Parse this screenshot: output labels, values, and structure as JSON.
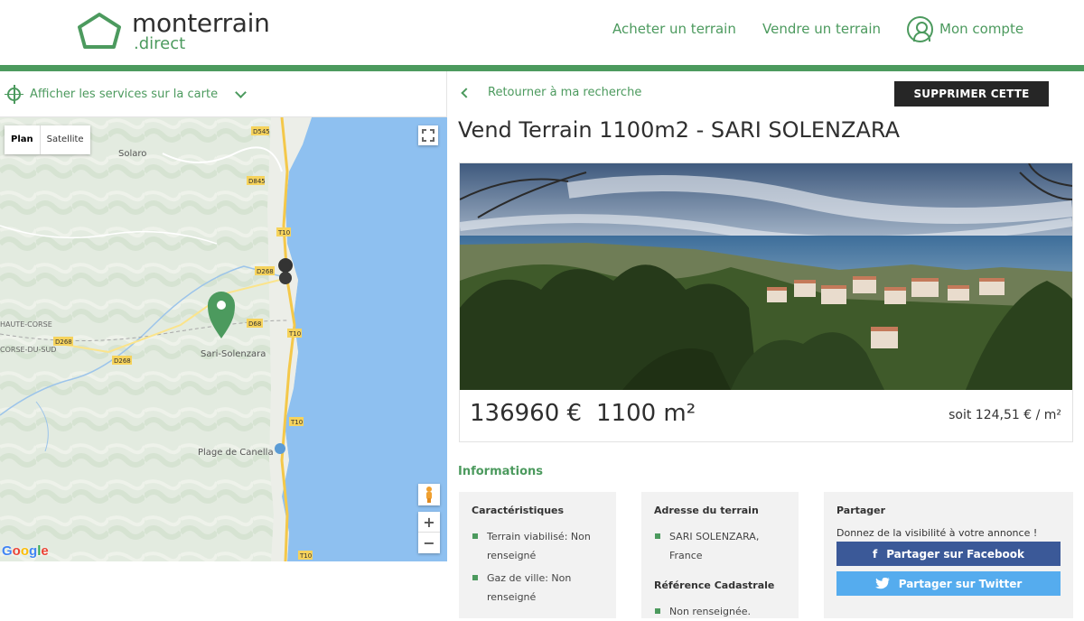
{
  "header": {
    "logo_main": "monterrain",
    "logo_sub": ".direct",
    "nav_buy": "Acheter un terrain",
    "nav_sell": "Vendre un terrain",
    "nav_account": "Mon compte"
  },
  "map_panel": {
    "services_label": "Afficher les services sur la carte",
    "map_type_plan": "Plan",
    "map_type_satellite": "Satellite",
    "labels": {
      "solaro": "Solaro",
      "sari": "Sari-Solenzara",
      "haute_corse": "HAUTE-CORSE",
      "corse_du_sud": "CORSE-DU-SUD",
      "canella": "Plage de Canella",
      "d545": "D545",
      "d845": "D845",
      "t10": "T10",
      "d268": "D268",
      "d68": "D68"
    },
    "google": "Google"
  },
  "listing": {
    "back_label": "Retourner à ma recherche",
    "delete_label": "SUPPRIMER CETTE FICHE",
    "title": "Vend Terrain 1100m2 - SARI SOLENZARA",
    "price": "136960 €",
    "area": "1100 m²",
    "price_per_m2": "soit 124,51 € / m²"
  },
  "info": {
    "section_title": "Informations",
    "characteristics": {
      "title": "Caractéristiques",
      "items": [
        "Terrain viabilisé: Non renseigné",
        "Gaz de ville: Non renseigné"
      ]
    },
    "address": {
      "title": "Adresse du terrain",
      "value": "SARI SOLENZARA, France",
      "cadastral_title": "Référence Cadastrale",
      "cadastral_value": "Non renseignée."
    },
    "share": {
      "title": "Partager",
      "text": "Donnez de la visibilité à votre annonce !",
      "facebook": "Partager sur Facebook",
      "twitter": "Partager sur Twitter"
    }
  },
  "colors": {
    "brand_green": "#4c9a5e",
    "sea": "#8ec0f0",
    "dark_button": "#262626",
    "facebook": "#3b5998",
    "twitter": "#55acee"
  }
}
